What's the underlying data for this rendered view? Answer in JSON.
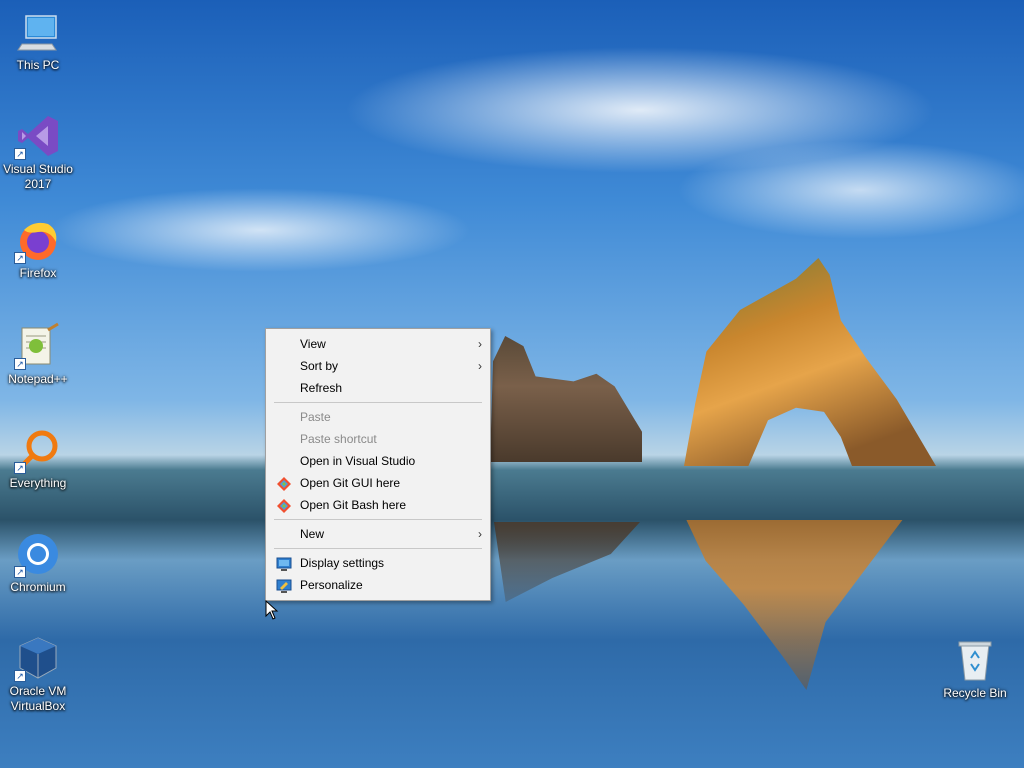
{
  "desktop": {
    "icons": [
      {
        "label": "This PC",
        "icon": "this-pc-icon"
      },
      {
        "label": "Visual Studio\n2017",
        "icon": "visual-studio-icon"
      },
      {
        "label": "Firefox",
        "icon": "firefox-icon"
      },
      {
        "label": "Notepad++",
        "icon": "notepad-plus-plus-icon"
      },
      {
        "label": "Everything",
        "icon": "everything-search-icon"
      },
      {
        "label": "Chromium",
        "icon": "chromium-icon"
      },
      {
        "label": "Oracle VM\nVirtualBox",
        "icon": "virtualbox-icon"
      },
      {
        "label": "Recycle Bin",
        "icon": "recycle-bin-icon"
      }
    ]
  },
  "context_menu": {
    "items": [
      {
        "label": "View",
        "submenu": true,
        "enabled": true
      },
      {
        "label": "Sort by",
        "submenu": true,
        "enabled": true
      },
      {
        "label": "Refresh",
        "enabled": true
      },
      {
        "label": "Paste",
        "enabled": false
      },
      {
        "label": "Paste shortcut",
        "enabled": false
      },
      {
        "label": "Open in Visual Studio",
        "enabled": true
      },
      {
        "label": "Open Git GUI here",
        "enabled": true,
        "icon": "git-icon"
      },
      {
        "label": "Open Git Bash here",
        "enabled": true,
        "icon": "git-icon"
      },
      {
        "label": "New",
        "submenu": true,
        "enabled": true
      },
      {
        "label": "Display settings",
        "enabled": true,
        "icon": "display-settings-icon"
      },
      {
        "label": "Personalize",
        "enabled": true,
        "icon": "personalize-icon"
      }
    ],
    "arrow_glyph": "›"
  },
  "colors": {
    "menu_background": "#f2f2f2",
    "disabled_text": "#8a8a8a",
    "icon_label_text": "#ffffff"
  }
}
